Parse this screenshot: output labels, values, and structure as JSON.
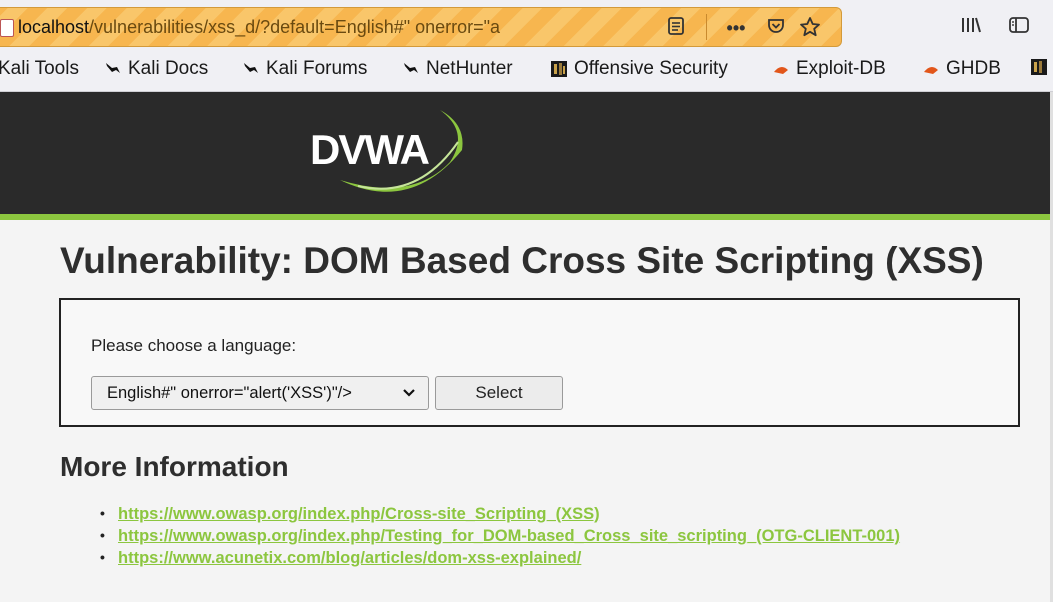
{
  "browser": {
    "url_host": "localhost",
    "url_path": "/vulnerabilities/xss_d/?default=English#\" onerror=\"a",
    "icons": [
      "site-icon",
      "reader-view-icon",
      "page-actions-icon",
      "pocket-icon",
      "bookmark-star-icon",
      "library-icon",
      "sidebar-icon"
    ]
  },
  "bookmarks": [
    {
      "label": "Kali Tools",
      "icon": "none"
    },
    {
      "label": "Kali Docs",
      "icon": "kali-dragon-icon"
    },
    {
      "label": "Kali Forums",
      "icon": "kali-dragon-icon"
    },
    {
      "label": "NetHunter",
      "icon": "kali-dragon-icon"
    },
    {
      "label": "Offensive Security",
      "icon": "offsec-icon"
    },
    {
      "label": "Exploit-DB",
      "icon": "exploit-db-icon"
    },
    {
      "label": "GHDB",
      "icon": "exploit-db-icon"
    }
  ],
  "header": {
    "logo_text": "DVWA",
    "accent_color": "#8cc63f"
  },
  "page": {
    "title": "Vulnerability: DOM Based Cross Site Scripting (XSS)",
    "language_label": "Please choose a language:",
    "language_selected": "English#\" onerror=\"alert('XSS')\"/>",
    "select_button": "Select",
    "more_info_title": "More Information",
    "links": [
      "https://www.owasp.org/index.php/Cross-site_Scripting_(XSS)",
      "https://www.owasp.org/index.php/Testing_for_DOM-based_Cross_site_scripting_(OTG-CLIENT-001)",
      "https://www.acunetix.com/blog/articles/dom-xss-explained/"
    ]
  }
}
